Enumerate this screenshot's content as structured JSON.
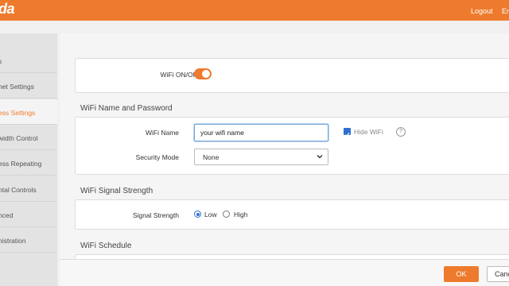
{
  "header": {
    "logo": "da",
    "logout_label": "Logout",
    "lang_label": "En",
    "accent_color": "#ee7b2d"
  },
  "sidebar": {
    "items": [
      {
        "label": "s"
      },
      {
        "label": "net Settings"
      },
      {
        "label": "ess Settings",
        "active": true
      },
      {
        "label": "width Control"
      },
      {
        "label": "ess Repeating"
      },
      {
        "label": "ntal Controls"
      },
      {
        "label": "nced"
      },
      {
        "label": "nistration"
      }
    ]
  },
  "wifi_switch": {
    "label": "WiFi ON/OFF",
    "state": "on"
  },
  "name_password": {
    "title": "WiFi Name and Password",
    "wifi_name_label": "WiFi Name",
    "wifi_name_value": "your wifi name",
    "hide_wifi_label": "Hide WiFi",
    "hide_wifi_checked": true,
    "help_icon": "question-icon",
    "help_symbol": "?",
    "security_label": "Security Mode",
    "security_value": "None"
  },
  "signal": {
    "title": "WiFi Signal Strength",
    "label": "Signal Strength",
    "options": [
      {
        "label": "Low",
        "selected": true
      },
      {
        "label": "High",
        "selected": false
      }
    ]
  },
  "schedule": {
    "title": "WiFi Schedule"
  },
  "footer": {
    "ok_label": "OK",
    "cancel_label": "Cancel"
  }
}
